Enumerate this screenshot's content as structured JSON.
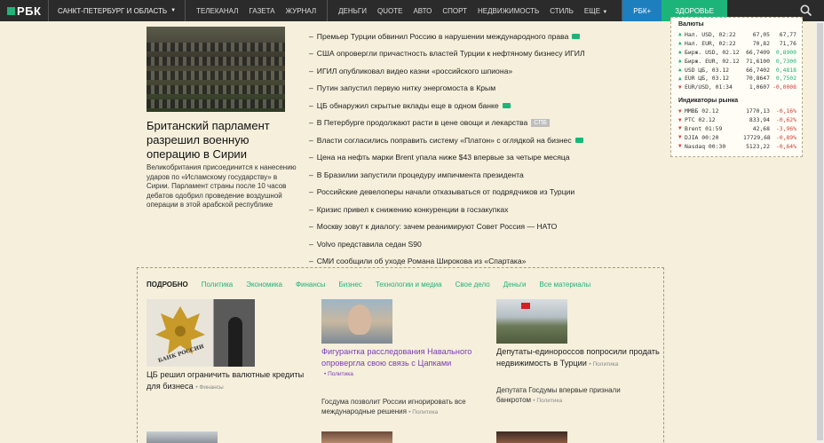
{
  "topbar": {
    "logo": "РБК",
    "region": "САНКТ-ПЕТЕРБУРГ И ОБЛАСТЬ",
    "group1": [
      "ТЕЛЕКАНАЛ",
      "ГАЗЕТА",
      "ЖУРНАЛ"
    ],
    "group2": [
      "ДЕНЬГИ",
      "QUOTE",
      "АВТО",
      "СПОРТ",
      "НЕДВИЖИМОСТЬ",
      "СТИЛЬ",
      "ЕЩЕ"
    ],
    "rbk_plus": "РБК+",
    "health": "ЗДОРОВЬЕ"
  },
  "lead": {
    "title": "Британский парламент разрешил военную операцию в Сирии",
    "desc": "Великобритания присоединится к нанесению ударов по «Исламскому государству» в Сирии. Парламент страны после 10 часов дебатов одобрил проведение воздушной операции в этой арабской республике"
  },
  "news": [
    {
      "text": "Премьер Турции обвинил Россию в нарушении международного права",
      "video": true
    },
    {
      "text": "США опровергли причастность властей Турции к нефтяному бизнесу ИГИЛ"
    },
    {
      "text": "ИГИЛ опубликовал видео казни «российского шпиона»"
    },
    {
      "text": "Путин запустил первую нитку энергомоста в Крым"
    },
    {
      "text": "ЦБ обнаружил скрытые вклады еще в одном банке",
      "video": true
    },
    {
      "text": "В Петербурге продолжают расти в цене овощи и лекарства",
      "tag": "СПБ"
    },
    {
      "text": "Власти согласились поправить систему «Платон» с оглядкой на бизнес",
      "video": true
    },
    {
      "text": "Цена на нефть марки Brent упала ниже $43 впервые за четыре месяца"
    },
    {
      "text": "В Бразилии запустили процедуру импичмента президента"
    },
    {
      "text": "Российские девелоперы начали отказываться от подрядчиков из Турции"
    },
    {
      "text": "Кризис привел к снижению конкуренции в госзакупках"
    },
    {
      "text": "Москву зовут к диалогу: зачем реанимируют Совет Россия — НАТО"
    },
    {
      "text": "Volvo представила седан S90"
    },
    {
      "text": "СМИ сообщили об уходе Романа Широкова из «Спартака»"
    }
  ],
  "quotes": {
    "currencies_title": "Валюты",
    "currencies": [
      {
        "name": "Нал. USD, 02:22",
        "v1": "67,05",
        "v2": "67,77",
        "dir": "up"
      },
      {
        "name": "Нал. EUR, 02:22",
        "v1": "70,82",
        "v2": "71,76",
        "dir": "up"
      },
      {
        "name": "Бирж. USD, 02.12",
        "v1": "66,7409",
        "v2": "0,8900",
        "dir": "up"
      },
      {
        "name": "Бирж. EUR, 02.12",
        "v1": "71,6100",
        "v2": "0,7300",
        "dir": "up"
      },
      {
        "name": "USD ЦБ, 03.12",
        "v1": "66,7402",
        "v2": "0,4818",
        "dir": "up"
      },
      {
        "name": "EUR ЦБ, 03.12",
        "v1": "70,8647",
        "v2": "0,7502",
        "dir": "up"
      },
      {
        "name": "EUR/USD, 01:34",
        "v1": "1,0607",
        "v2": "-0,0008",
        "dir": "down"
      }
    ],
    "indicators_title": "Индикаторы рынка",
    "indicators": [
      {
        "name": "ММВБ 02.12",
        "v1": "1770,13",
        "v2": "-0,16%",
        "dir": "down"
      },
      {
        "name": "РТС 02.12",
        "v1": "833,94",
        "v2": "-0,62%",
        "dir": "down"
      },
      {
        "name": "Brent 01:59",
        "v1": "42,68",
        "v2": "-3,96%",
        "dir": "down"
      },
      {
        "name": "DJIA 00:20",
        "v1": "17729,68",
        "v2": "-0,89%",
        "dir": "down"
      },
      {
        "name": "Nasdaq 00:30",
        "v1": "5123,22",
        "v2": "-0,64%",
        "dir": "down"
      }
    ]
  },
  "detail": {
    "tabs": [
      "ПОДРОБНО",
      "Политика",
      "Экономика",
      "Финансы",
      "Бизнес",
      "Технологии и медиа",
      "Свое дело",
      "Деньги",
      "Все материалы"
    ],
    "card1_title": "ЦБ решил ограничить валютные кредиты для бизнеса",
    "card1_cat": "• Финансы",
    "card2_title": "Фигурантка расследования Навального опровергла свою связь с Цапками",
    "card2_cat": "• Политика",
    "card2_small": "Госдума позволит России игнорировать все международные решения",
    "card2_small_cat": "• Политика",
    "card3_title": "Депутаты-единороссов попросили продать недвижимость в Турции",
    "card3_cat": "• Политика",
    "card3_small": "Депутата Госдумы впервые признали банкротом",
    "card3_small_cat": "• Политика",
    "bank_sign": "БАНК РОССИИ"
  }
}
